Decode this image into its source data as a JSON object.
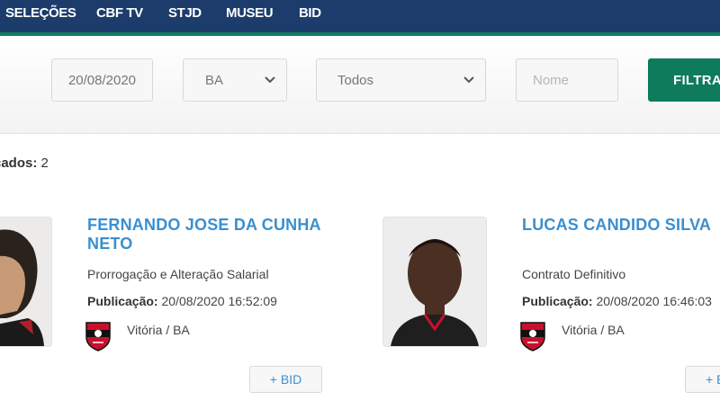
{
  "nav": {
    "items": [
      "SELEÇÕES",
      "CBF TV",
      "STJD",
      "MUSEU",
      "BID"
    ]
  },
  "filters": {
    "date": "20/08/2020",
    "state": "BA",
    "type": "Todos",
    "name_placeholder": "Nome",
    "filter_button": "FILTRA"
  },
  "results": {
    "label": "cados:",
    "count": "2"
  },
  "players": [
    {
      "name_line1": "FERNANDO JOSE DA CUNHA",
      "name_line2": "NETO",
      "contract_type": "Prorrogação e Alteração Salarial",
      "publication_label": "Publicação:",
      "publication_date": "20/08/2020 16:52:09",
      "club": "Vitória / BA",
      "bid_button": "+ BID"
    },
    {
      "name_line1": "LUCAS CANDIDO SILVA",
      "name_line2": "",
      "contract_type": "Contrato Definitivo",
      "publication_label": "Publicação:",
      "publication_date": "20/08/2020 16:46:03",
      "club": "Vitória / BA",
      "bid_button": "+ B"
    }
  ],
  "colors": {
    "nav_bg": "#1c3c6b",
    "nav_accent": "#0e7e5f",
    "filter_button": "#0d7b5c",
    "player_name": "#3a8fcf",
    "crest_red": "#c8102e"
  }
}
